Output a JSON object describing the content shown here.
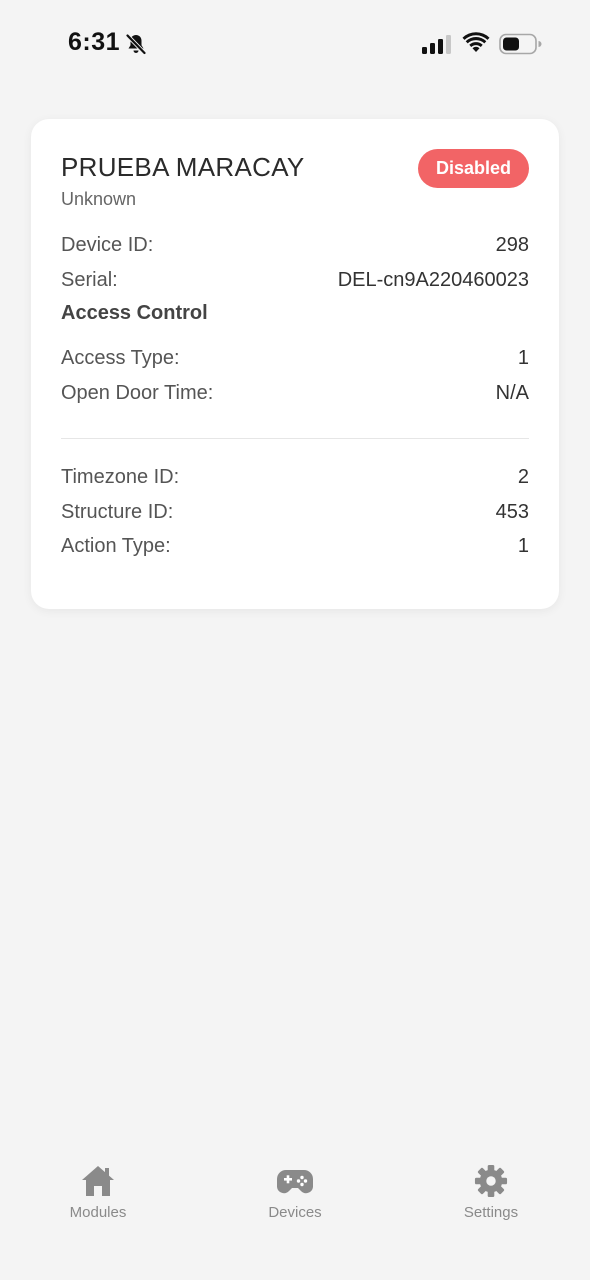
{
  "status_bar": {
    "time": "6:31",
    "icons": [
      "bell-slash-icon",
      "cellular-signal-icon",
      "wifi-icon",
      "battery-icon"
    ]
  },
  "device": {
    "name": "PRUEBA MARACAY",
    "subtitle": "Unknown",
    "status": "Disabled",
    "status_color": "#f26466",
    "fields": [
      {
        "label": "Device ID:",
        "value": "298"
      },
      {
        "label": "Serial:",
        "value": "DEL-cn9A220460023"
      }
    ],
    "access_control": {
      "title": "Access Control",
      "fields": [
        {
          "label": "Access Type:",
          "value": "1"
        },
        {
          "label": "Open Door Time:",
          "value": "N/A"
        }
      ]
    },
    "extra_fields": [
      {
        "label": "Timezone ID:",
        "value": "2"
      },
      {
        "label": "Structure ID:",
        "value": "453"
      },
      {
        "label": "Action Type:",
        "value": "1"
      }
    ]
  },
  "tab_bar": {
    "items": [
      {
        "label": "Modules",
        "icon": "home-icon"
      },
      {
        "label": "Devices",
        "icon": "gamepad-icon"
      },
      {
        "label": "Settings",
        "icon": "gear-icon"
      }
    ]
  }
}
